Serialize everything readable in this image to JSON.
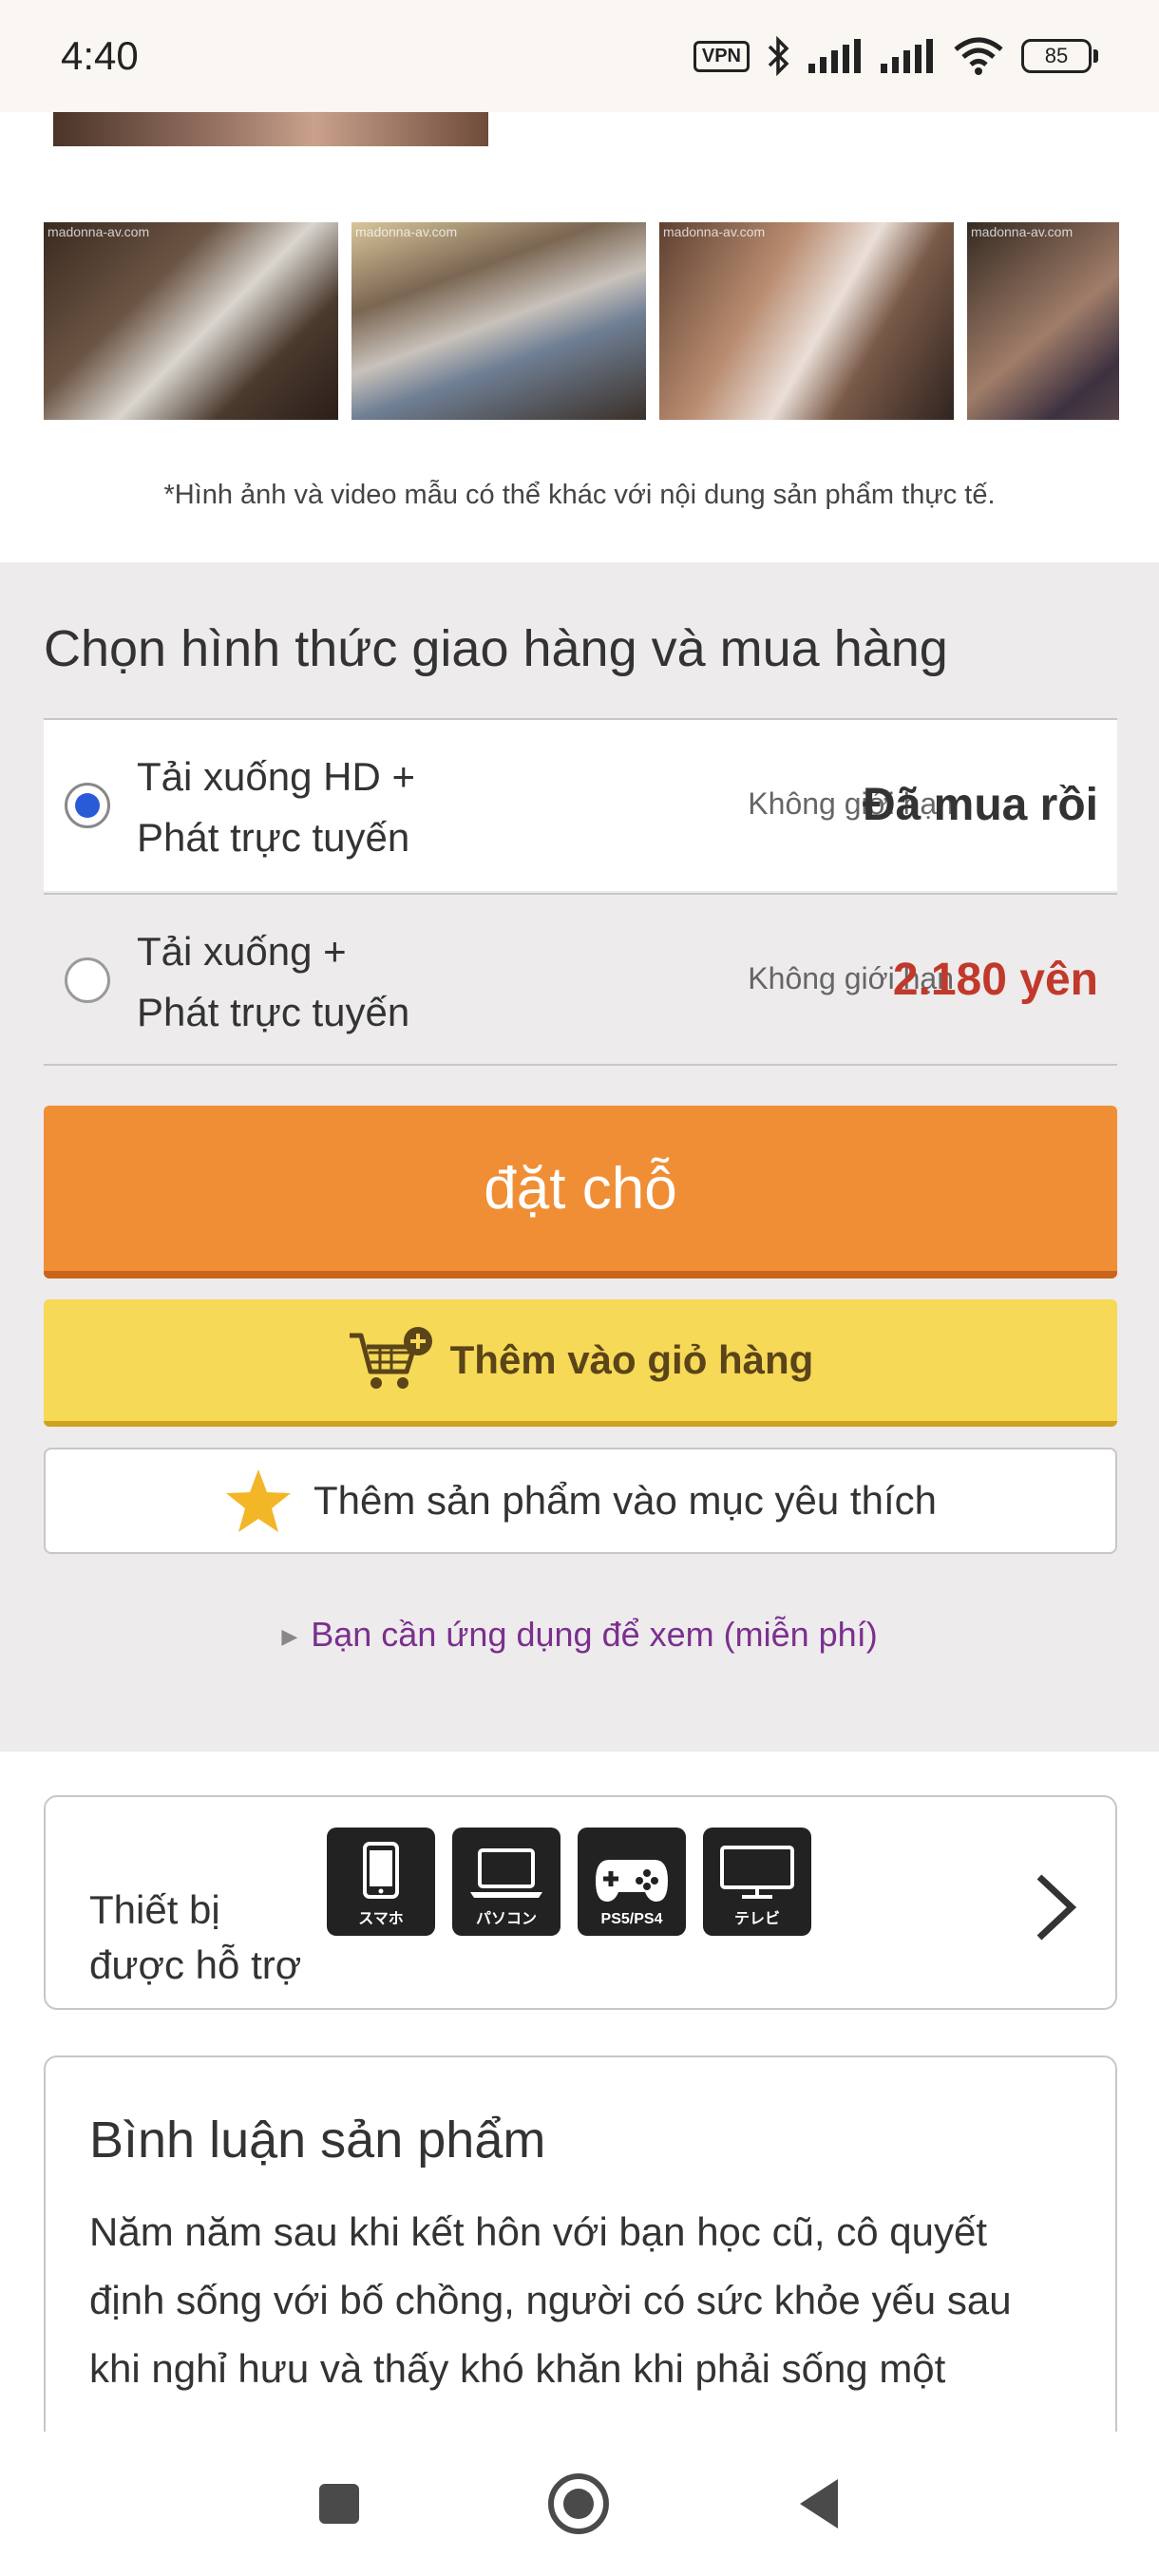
{
  "status_bar": {
    "time": "4:40",
    "vpn": "VPN",
    "battery": "85"
  },
  "gallery": {
    "thumbnails": [
      {
        "caption": "madonna-av.com"
      },
      {
        "caption": "madonna-av.com"
      },
      {
        "caption": "madonna-av.com"
      },
      {
        "caption": "madonna-av.com"
      }
    ],
    "disclaimer": "*Hình ảnh và video mẫu có thể khác với nội dung sản phẩm thực tế."
  },
  "purchase": {
    "title": "Chọn hình thức giao hàng và mua hàng",
    "options": [
      {
        "name_line1": "Tải xuống HD +",
        "name_line2": "Phát trực tuyến",
        "limit": "Không giới hạn",
        "price": "Đã mua rồi",
        "selected": true
      },
      {
        "name_line1": "Tải xuống +",
        "name_line2": "Phát trực tuyến",
        "limit": "Không giới hạn",
        "price": "2.180 yên",
        "selected": false
      }
    ],
    "reserve_label": "đặt chỗ",
    "cart_label": "Thêm vào giỏ hàng",
    "favorite_label": "Thêm sản phẩm vào mục yêu thích",
    "app_link": "Bạn cần ứng dụng để xem (miễn phí)"
  },
  "devices": {
    "label_line1": "Thiết bị",
    "label_line2": "được hỗ trợ",
    "items": [
      {
        "icon": "smartphone-icon",
        "label": "スマホ"
      },
      {
        "icon": "laptop-icon",
        "label": "パソコン"
      },
      {
        "icon": "gamepad-icon",
        "label": "PS5/PS4"
      },
      {
        "icon": "tv-icon",
        "label": "テレビ"
      }
    ]
  },
  "review": {
    "title": "Bình luận sản phẩm",
    "line1": "Năm năm sau khi kết hôn với bạn học cũ, cô quyết",
    "line2": "định sống với bố chồng, người có sức khỏe yếu sau",
    "line3": "khi nghỉ hưu và thấy khó khăn khi phải sống một"
  },
  "colors": {
    "reserve": "#f08e36",
    "cart": "#f6d957",
    "price_red": "#c0392b",
    "link": "#7b2f8f",
    "radio": "#2a5bd7"
  }
}
